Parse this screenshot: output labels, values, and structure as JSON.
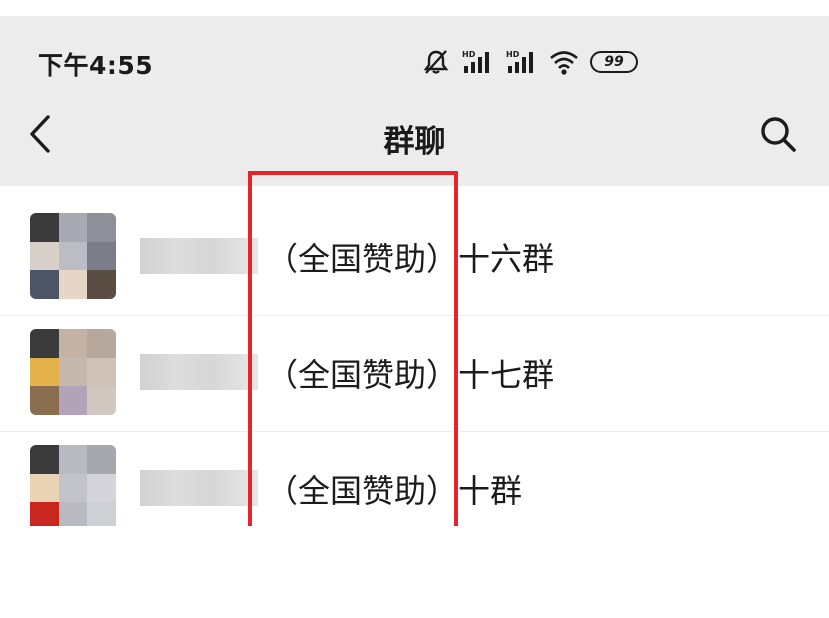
{
  "status_bar": {
    "time": "下午4:55",
    "icons": [
      "mute-bell-icon",
      "hd-signal-icon",
      "hd-signal-icon",
      "wifi-icon",
      "battery-icon"
    ],
    "battery": "99"
  },
  "nav": {
    "back_icon": "chevron-left-icon",
    "title": "群聊",
    "search_icon": "search-icon"
  },
  "groups": [
    {
      "name": "（全国赞助）十六群"
    },
    {
      "name": "（全国赞助）十七群"
    },
    {
      "name": "（全国赞助）十群"
    }
  ],
  "colors": {
    "header_bg": "#ececec",
    "highlight": "#e8242a",
    "text": "#1b1b1b"
  }
}
